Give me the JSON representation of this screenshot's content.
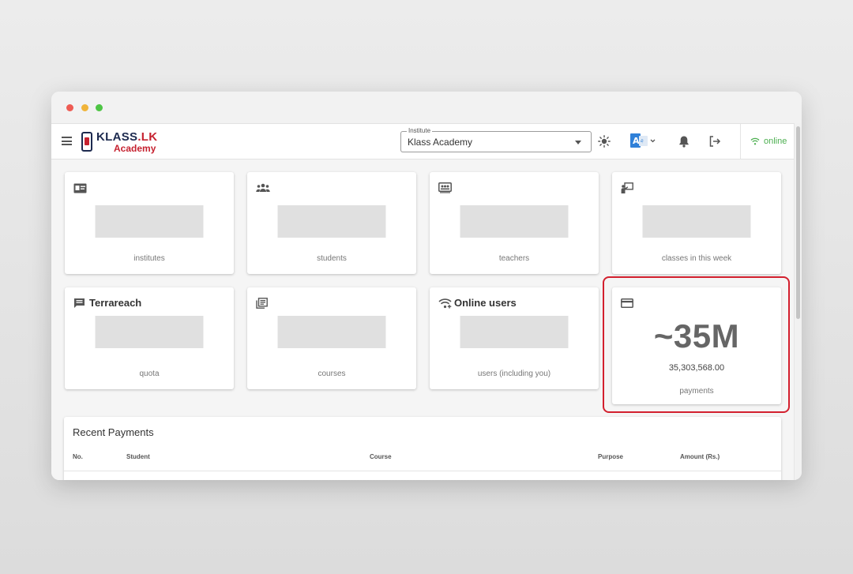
{
  "app": {
    "logo": {
      "brand": "KLASS",
      "suffix": ".LK",
      "subtitle": "Academy"
    }
  },
  "header": {
    "institute_label": "Institute",
    "institute_value": "Klass Academy",
    "status": "online"
  },
  "stats": [
    {
      "title": "",
      "caption": "institutes",
      "icon": "id-card-icon"
    },
    {
      "title": "",
      "caption": "students",
      "icon": "people-icon"
    },
    {
      "title": "",
      "caption": "teachers",
      "icon": "board-icon"
    },
    {
      "title": "",
      "caption": "classes in this week",
      "icon": "presenter-icon"
    },
    {
      "title": "Terrareach",
      "caption": "quota",
      "icon": "message-icon"
    },
    {
      "title": "",
      "caption": "courses",
      "icon": "library-icon"
    },
    {
      "title": "Online users",
      "caption": "users (including you)",
      "icon": "wifi-add-icon"
    }
  ],
  "payments_card": {
    "big_value": "~35M",
    "amount": "35,303,568.00",
    "caption": "payments",
    "icon": "credit-card-icon"
  },
  "recent_payments": {
    "title": "Recent Payments",
    "columns": [
      "No.",
      "Student",
      "Course",
      "Purpose",
      "Amount (Rs.)"
    ]
  },
  "colors": {
    "accent_red": "#d3202e",
    "online_green": "#4caf50",
    "brand_navy": "#1d2a4f"
  }
}
